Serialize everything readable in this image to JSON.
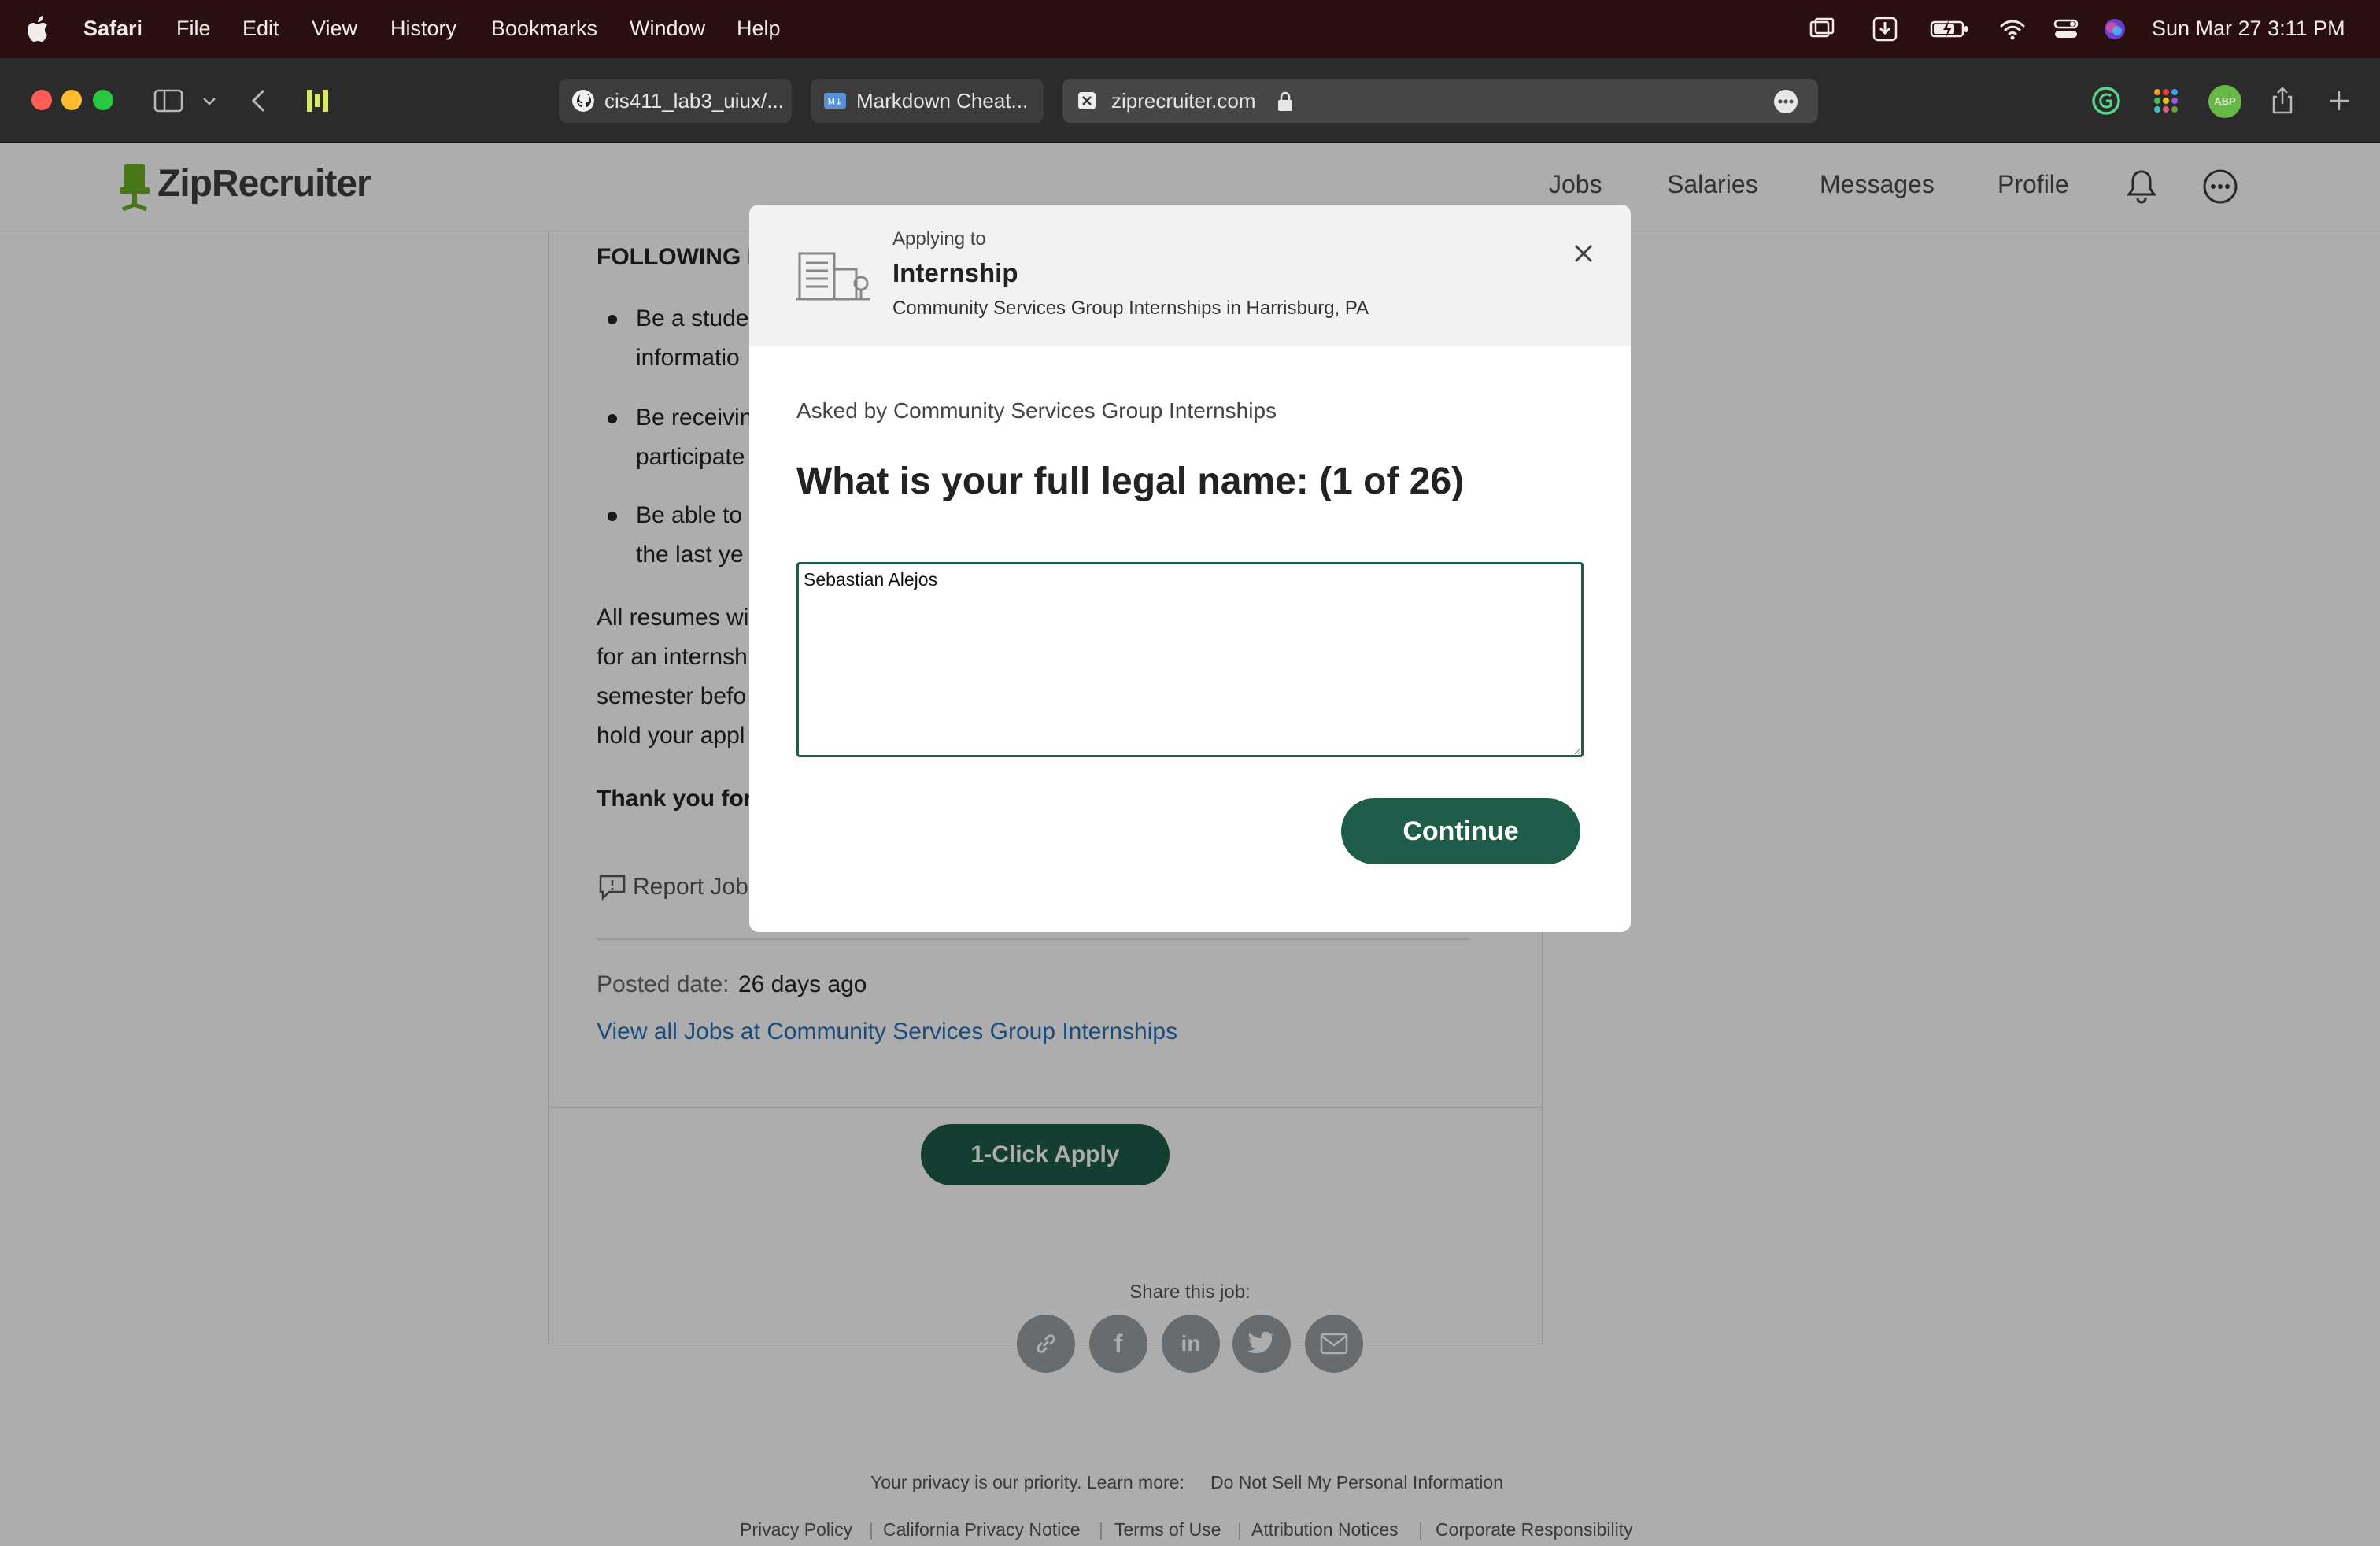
{
  "menubar": {
    "app": "Safari",
    "items": [
      "File",
      "Edit",
      "View",
      "History",
      "Bookmarks",
      "Window",
      "Help"
    ],
    "clock": "Sun Mar 27  3:11 PM"
  },
  "browser": {
    "tabs": [
      {
        "label": "cis411_lab3_uiux/...",
        "icon": "github-icon"
      },
      {
        "label": "Markdown Cheat...",
        "icon": "markdown-icon"
      },
      {
        "label": "ziprecruiter.com",
        "icon": "ziprecruiter-favicon"
      }
    ],
    "ext_badge": "ABP"
  },
  "site": {
    "logo": "ZipRecruiter",
    "nav": [
      "Jobs",
      "Salaries",
      "Messages",
      "Profile"
    ]
  },
  "job": {
    "following_heading": "FOLLOWING I",
    "bullets": [
      [
        "Be a stude",
        "informatio"
      ],
      [
        "Be receivin",
        "participate"
      ],
      [
        "Be able to",
        "the last ye"
      ]
    ],
    "resume_lines": [
      "All resumes wi",
      "for an internsh",
      "semester befo",
      "hold your appl"
    ],
    "thanks": "Thank you for",
    "report": "Report Job",
    "posted_label": "Posted date:",
    "posted_value": "26 days ago",
    "view_all": "View all Jobs at Community Services Group Internships",
    "apply_button": "1-Click Apply"
  },
  "share": {
    "label": "Share this job:",
    "icons": [
      "link-icon",
      "facebook-icon",
      "linkedin-icon",
      "twitter-icon",
      "email-icon"
    ]
  },
  "footer": {
    "privacy_text": "Your privacy is our priority. Learn more:",
    "do_not_sell": "Do Not Sell My Personal Information",
    "links": [
      "Privacy Policy",
      "California Privacy Notice",
      "Terms of Use",
      "Attribution Notices",
      "Corporate Responsibility"
    ]
  },
  "modal": {
    "applying_to": "Applying to",
    "job_title": "Internship",
    "company_location": "Community Services Group Internships in Harrisburg, PA",
    "asked_by": "Asked by Community Services Group Internships",
    "question": "What is your full legal name: (1 of 26)",
    "answer": "Sebastian Alejos\n",
    "continue_label": "Continue"
  },
  "colors": {
    "brand_green": "#1f5c4a",
    "link_blue": "#2a6fb8",
    "menubar_bg": "#2a0f10"
  }
}
